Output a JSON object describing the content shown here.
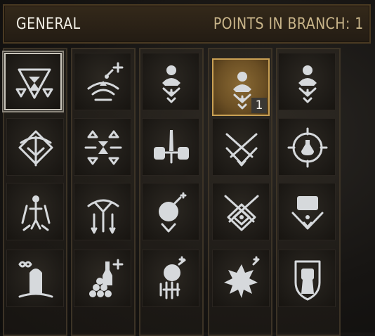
{
  "header": {
    "title": "GENERAL",
    "points": "POINTS IN BRANCH: 1"
  },
  "skills": [
    {
      "icon": "hourglass-signs-icon",
      "selected": true,
      "level": ""
    },
    {
      "icon": "sign-bowl-plus-icon",
      "level": ""
    },
    {
      "icon": "bust-sign-icon",
      "level": ""
    },
    {
      "icon": "bust-sign-icon",
      "active": true,
      "level": "1"
    },
    {
      "icon": "bust-sign-icon",
      "level": ""
    },
    {
      "icon": "crossbow-diamond-icon",
      "level": ""
    },
    {
      "icon": "hourglass-triangles-icon",
      "level": ""
    },
    {
      "icon": "fists-sword-icon",
      "level": ""
    },
    {
      "icon": "crossed-swords-sign-icon",
      "level": ""
    },
    {
      "icon": "potion-target-icon",
      "level": ""
    },
    {
      "icon": "figure-arrows-icon",
      "level": ""
    },
    {
      "icon": "crossbow-arrows-icon",
      "level": ""
    },
    {
      "icon": "bomb-sign-icon",
      "level": ""
    },
    {
      "icon": "crossed-swords-diamond-icon",
      "level": ""
    },
    {
      "icon": "chest-sign-icon",
      "level": ""
    },
    {
      "icon": "infinity-tombstone-icon",
      "level": ""
    },
    {
      "icon": "bottle-cannonballs-plus-icon",
      "level": ""
    },
    {
      "icon": "hand-bomb-icon",
      "level": ""
    },
    {
      "icon": "bomb-explosion-icon",
      "level": ""
    },
    {
      "icon": "fist-shield-icon",
      "level": ""
    }
  ]
}
